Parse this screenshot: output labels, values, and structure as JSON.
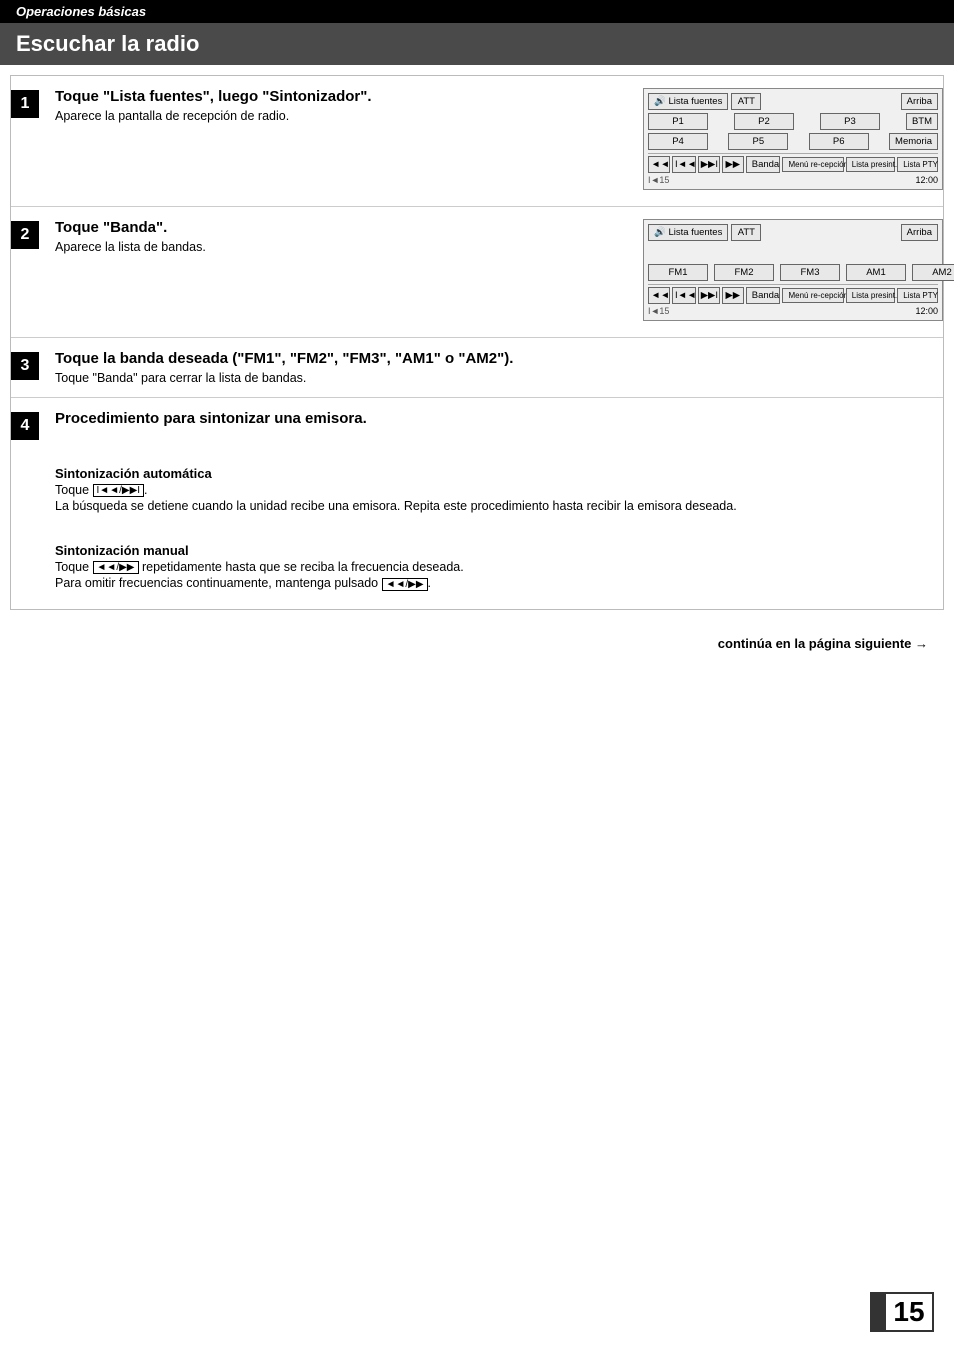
{
  "page": {
    "header": {
      "operaciones": "Operaciones básicas",
      "escuchar": "Escuchar la radio"
    },
    "steps": [
      {
        "number": "1",
        "title": "Toque \"Lista fuentes\", luego \"Sintonizador\".",
        "desc": "Aparece la pantalla de recepción de radio."
      },
      {
        "number": "2",
        "title": "Toque \"Banda\".",
        "desc": "Aparece la lista de bandas."
      },
      {
        "number": "3",
        "title": "Toque la banda deseada (\"FM1\", \"FM2\", \"FM3\", \"AM1\" o \"AM2\").",
        "desc": "Toque \"Banda\" para cerrar la lista de bandas."
      },
      {
        "number": "4",
        "title": "Procedimiento para sintonizar una emisora.",
        "sub": [
          {
            "title": "Sintonización automática",
            "lines": [
              "Toque ◄◄/▶▶.",
              "La búsqueda se detiene cuando la unidad recibe una emisora. Repita este procedimiento hasta recibir la emisora deseada."
            ]
          },
          {
            "title": "Sintonización manual",
            "lines": [
              "Toque ◄◄/▶▶ repetidamente hasta que se reciba la frecuencia deseada.",
              "Para omitir frecuencias continuamente, mantenga pulsado ◄◄/▶▶."
            ]
          }
        ]
      }
    ],
    "screen1": {
      "row1": [
        "Lista fuentes",
        "ATT",
        "Arriba"
      ],
      "row2": [
        "P1",
        "P2",
        "P3",
        "BTM"
      ],
      "row3": [
        "P4",
        "P5",
        "P6",
        "Memoria"
      ],
      "row4": [
        "◄◄",
        "I◄◄",
        "▶▶I",
        "▶▶",
        "Banda",
        "Menú recepción",
        "Lista presint.",
        "Lista PTY"
      ],
      "indicator": "I◄15",
      "time": "12:00"
    },
    "screen2": {
      "row1": [
        "Lista fuentes",
        "ATT",
        "Arriba"
      ],
      "bands": [
        "FM1",
        "FM2",
        "FM3",
        "AM1",
        "AM2"
      ],
      "row3": [
        "◄◄",
        "I◄◄",
        "▶▶I",
        "▶▶",
        "Banda",
        "Menú recepción",
        "Lista presint.",
        "Lista PTY"
      ],
      "indicator": "I◄15",
      "time": "12:00"
    },
    "continue": "continúa en la página siguiente →",
    "page_number": "15"
  }
}
